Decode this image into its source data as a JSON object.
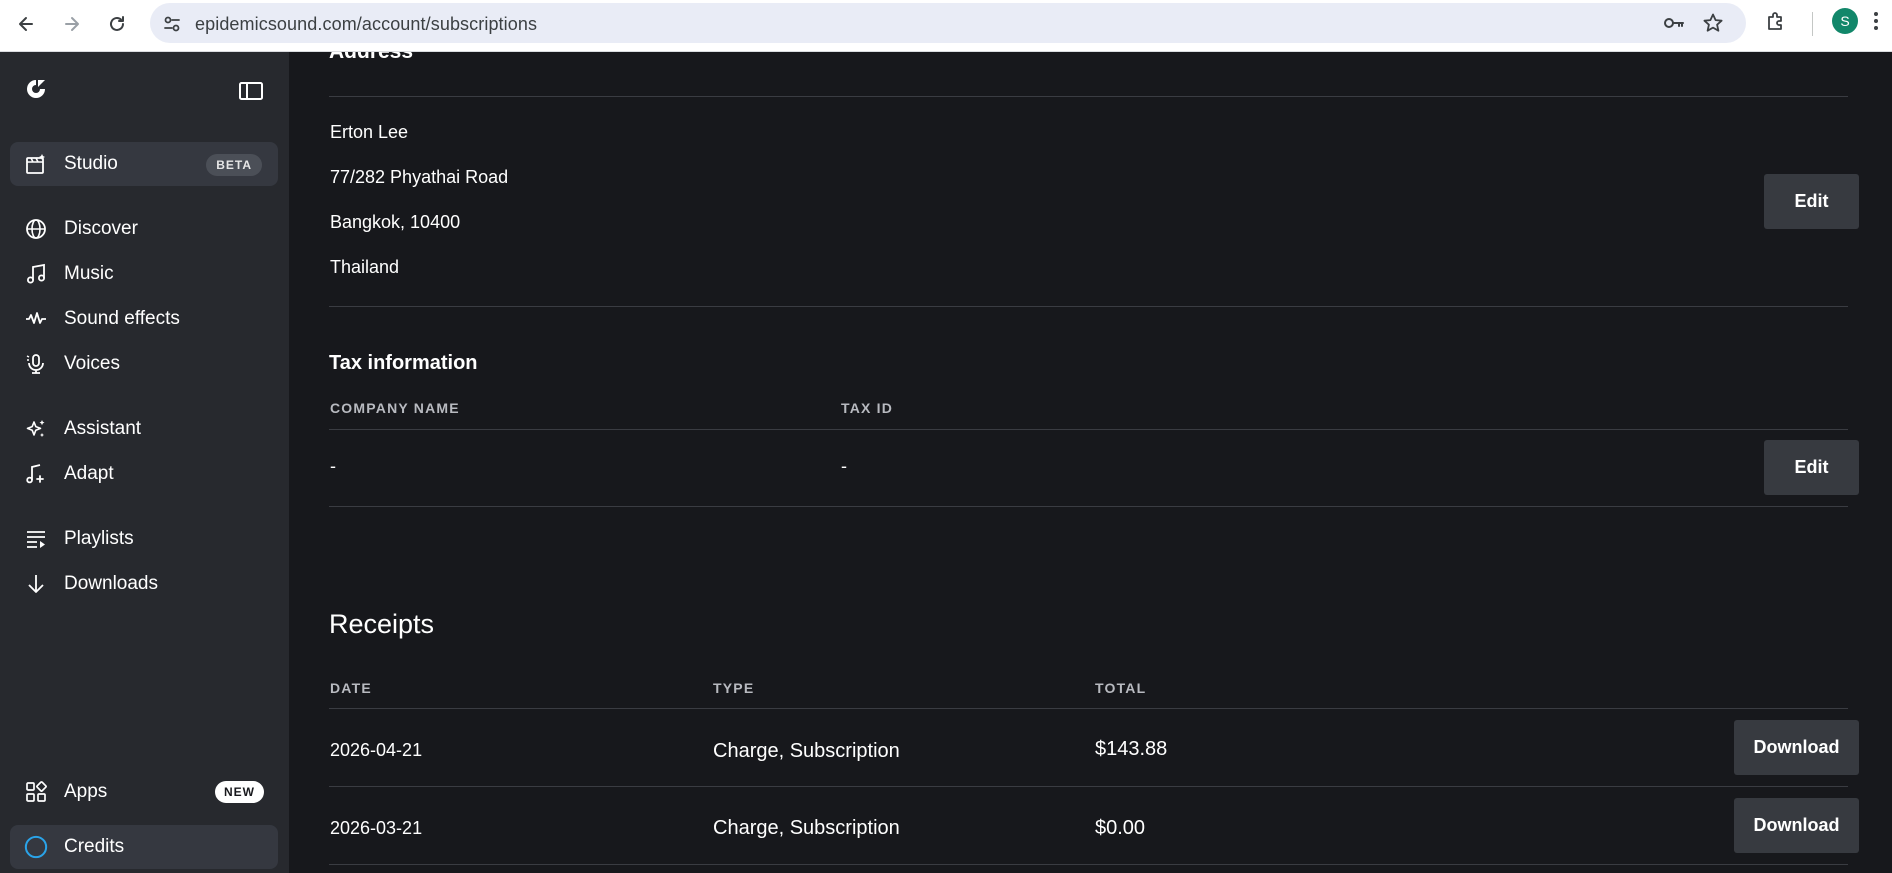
{
  "browser": {
    "url": "epidemicsound.com/account/subscriptions",
    "profile_initial": "S"
  },
  "sidebar": {
    "items": [
      {
        "id": "studio",
        "label": "Studio",
        "badge": "BETA",
        "icon": "studio-icon"
      },
      {
        "id": "discover",
        "label": "Discover",
        "icon": "globe-icon"
      },
      {
        "id": "music",
        "label": "Music",
        "icon": "music-note-icon"
      },
      {
        "id": "sound-effects",
        "label": "Sound effects",
        "icon": "waveform-icon"
      },
      {
        "id": "voices",
        "label": "Voices",
        "icon": "microphone-icon"
      },
      {
        "id": "assistant",
        "label": "Assistant",
        "icon": "sparkle-icon"
      },
      {
        "id": "adapt",
        "label": "Adapt",
        "icon": "adapt-icon"
      },
      {
        "id": "playlists",
        "label": "Playlists",
        "icon": "playlist-icon"
      },
      {
        "id": "downloads",
        "label": "Downloads",
        "icon": "download-arrow-icon"
      },
      {
        "id": "apps",
        "label": "Apps",
        "badge": "NEW",
        "icon": "apps-grid-icon"
      },
      {
        "id": "credits",
        "label": "Credits",
        "icon": "circle-icon"
      }
    ]
  },
  "address": {
    "heading": "Address",
    "lines": [
      "Erton Lee",
      "77/282 Phyathai Road",
      "Bangkok, 10400",
      "Thailand"
    ],
    "edit_label": "Edit"
  },
  "tax": {
    "heading": "Tax information",
    "columns": [
      "COMPANY NAME",
      "TAX ID"
    ],
    "values": [
      "-",
      "-"
    ],
    "edit_label": "Edit"
  },
  "receipts": {
    "heading": "Receipts",
    "columns": [
      "DATE",
      "TYPE",
      "TOTAL"
    ],
    "rows": [
      {
        "date": "2026-04-21",
        "type": "Charge, Subscription",
        "total": "$143.88",
        "action": "Download"
      },
      {
        "date": "2026-03-21",
        "type": "Charge, Subscription",
        "total": "$0.00",
        "action": "Download"
      }
    ]
  },
  "colors": {
    "page_bg": "#17181c",
    "sidebar_bg": "#27292e",
    "button_bg": "#373a40",
    "profile_green": "#12876a",
    "credits_ring": "#2aa3e8"
  }
}
